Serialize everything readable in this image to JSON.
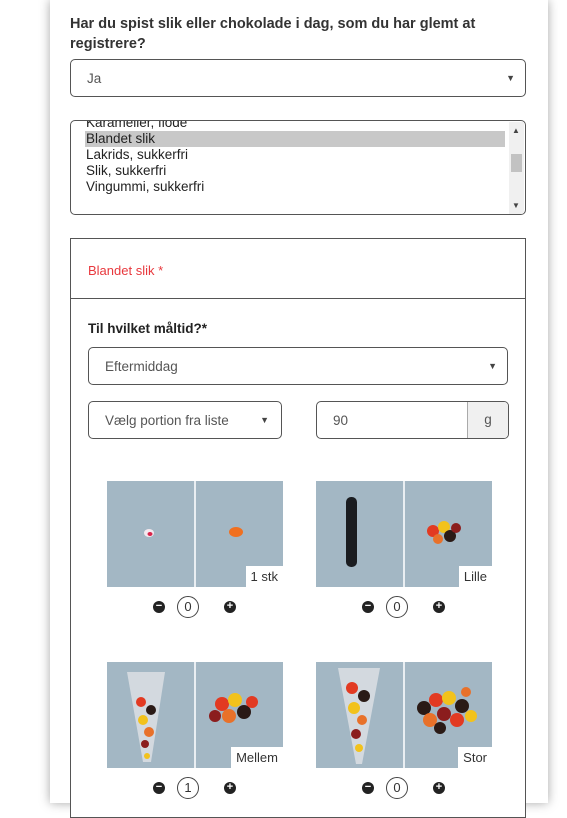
{
  "question": "Har du spist slik eller chokolade i dag, som du har glemt at registrere?",
  "answer_select": {
    "value": "Ja"
  },
  "candy_list": {
    "items": [
      "Karameller, flode",
      "Blandet slik",
      "Lakrids, sukkerfri",
      "Slik, sukkerfri",
      "Vingummi, sukkerfri"
    ],
    "selected": "Blandet slik"
  },
  "detail_panel": {
    "title": "Blandet slik *",
    "meal_label": "Til hvilket måltid?*",
    "meal_select": {
      "value": "Eftermiddag"
    },
    "portion_select": {
      "value": "Vælg portion fra liste"
    },
    "amount": {
      "value": "90",
      "unit": "g"
    },
    "portions": [
      {
        "label": "1 stk",
        "count": "0"
      },
      {
        "label": "Lille",
        "count": "0"
      },
      {
        "label": "Mellem",
        "count": "1"
      },
      {
        "label": "Stor",
        "count": "0"
      }
    ]
  },
  "colors": {
    "required_title": "#e8383d",
    "photo_bg": "#a3b7c4",
    "selected_item": "#c8c8c8"
  }
}
